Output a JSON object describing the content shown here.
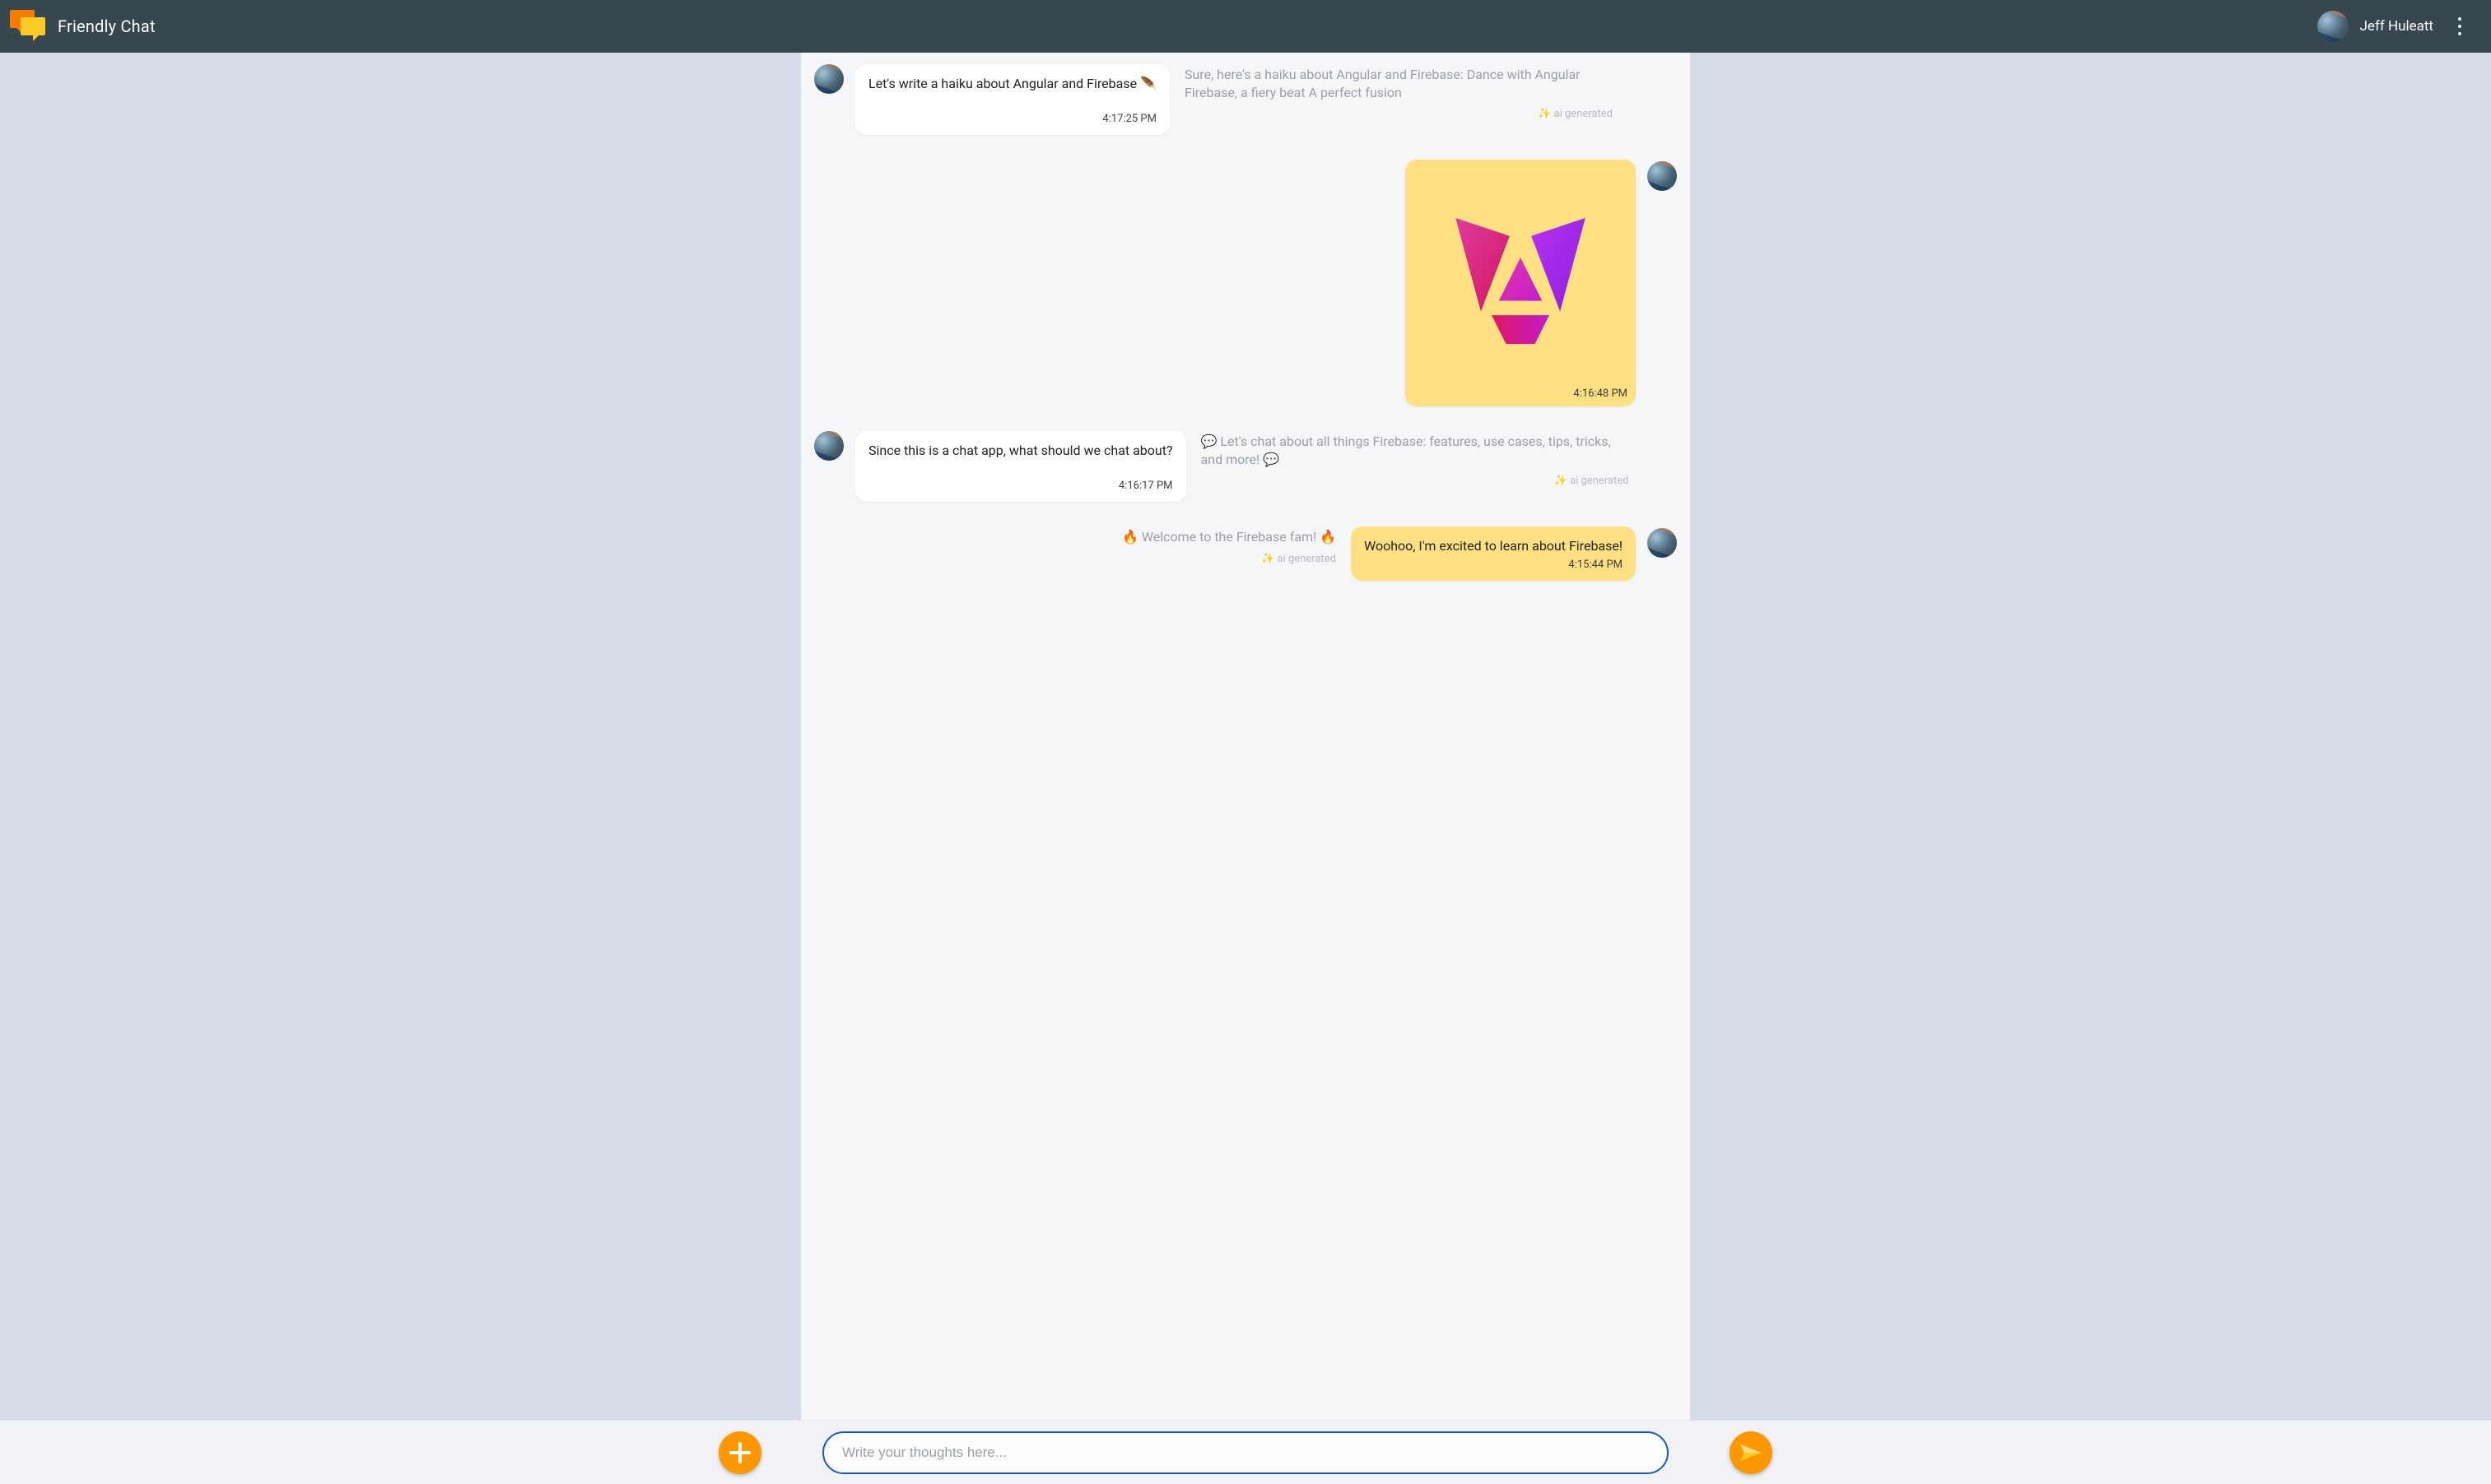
{
  "header": {
    "title": "Friendly Chat",
    "user_name": "Jeff Huleatt"
  },
  "messages": [
    {
      "side": "other",
      "text": "Let's write a haiku about Angular and Firebase 🪶",
      "time": "4:17:25 PM",
      "ai_text": "Sure, here's a haiku about Angular and Firebase: Dance with Angular Firebase, a fiery beat A perfect fusion",
      "ai_tag": "ai generated"
    },
    {
      "side": "me",
      "image": "angular-logo",
      "time": "4:16:48 PM"
    },
    {
      "side": "other",
      "text": "Since this is a chat app, what should we chat about?",
      "time": "4:16:17 PM",
      "ai_text": "💬 Let's chat about all things Firebase: features, use cases, tips, tricks, and more! 💬",
      "ai_tag": "ai generated"
    },
    {
      "side": "me",
      "text": "Woohoo, I'm excited to learn about Firebase!",
      "time": "4:15:44 PM",
      "ai_text": "🔥 Welcome to the Firebase fam! 🔥",
      "ai_tag": "ai generated"
    }
  ],
  "composer": {
    "placeholder": "Write your thoughts here..."
  },
  "icons": {
    "attach": "plus-icon",
    "send": "send-icon",
    "more": "more-vert-icon"
  }
}
